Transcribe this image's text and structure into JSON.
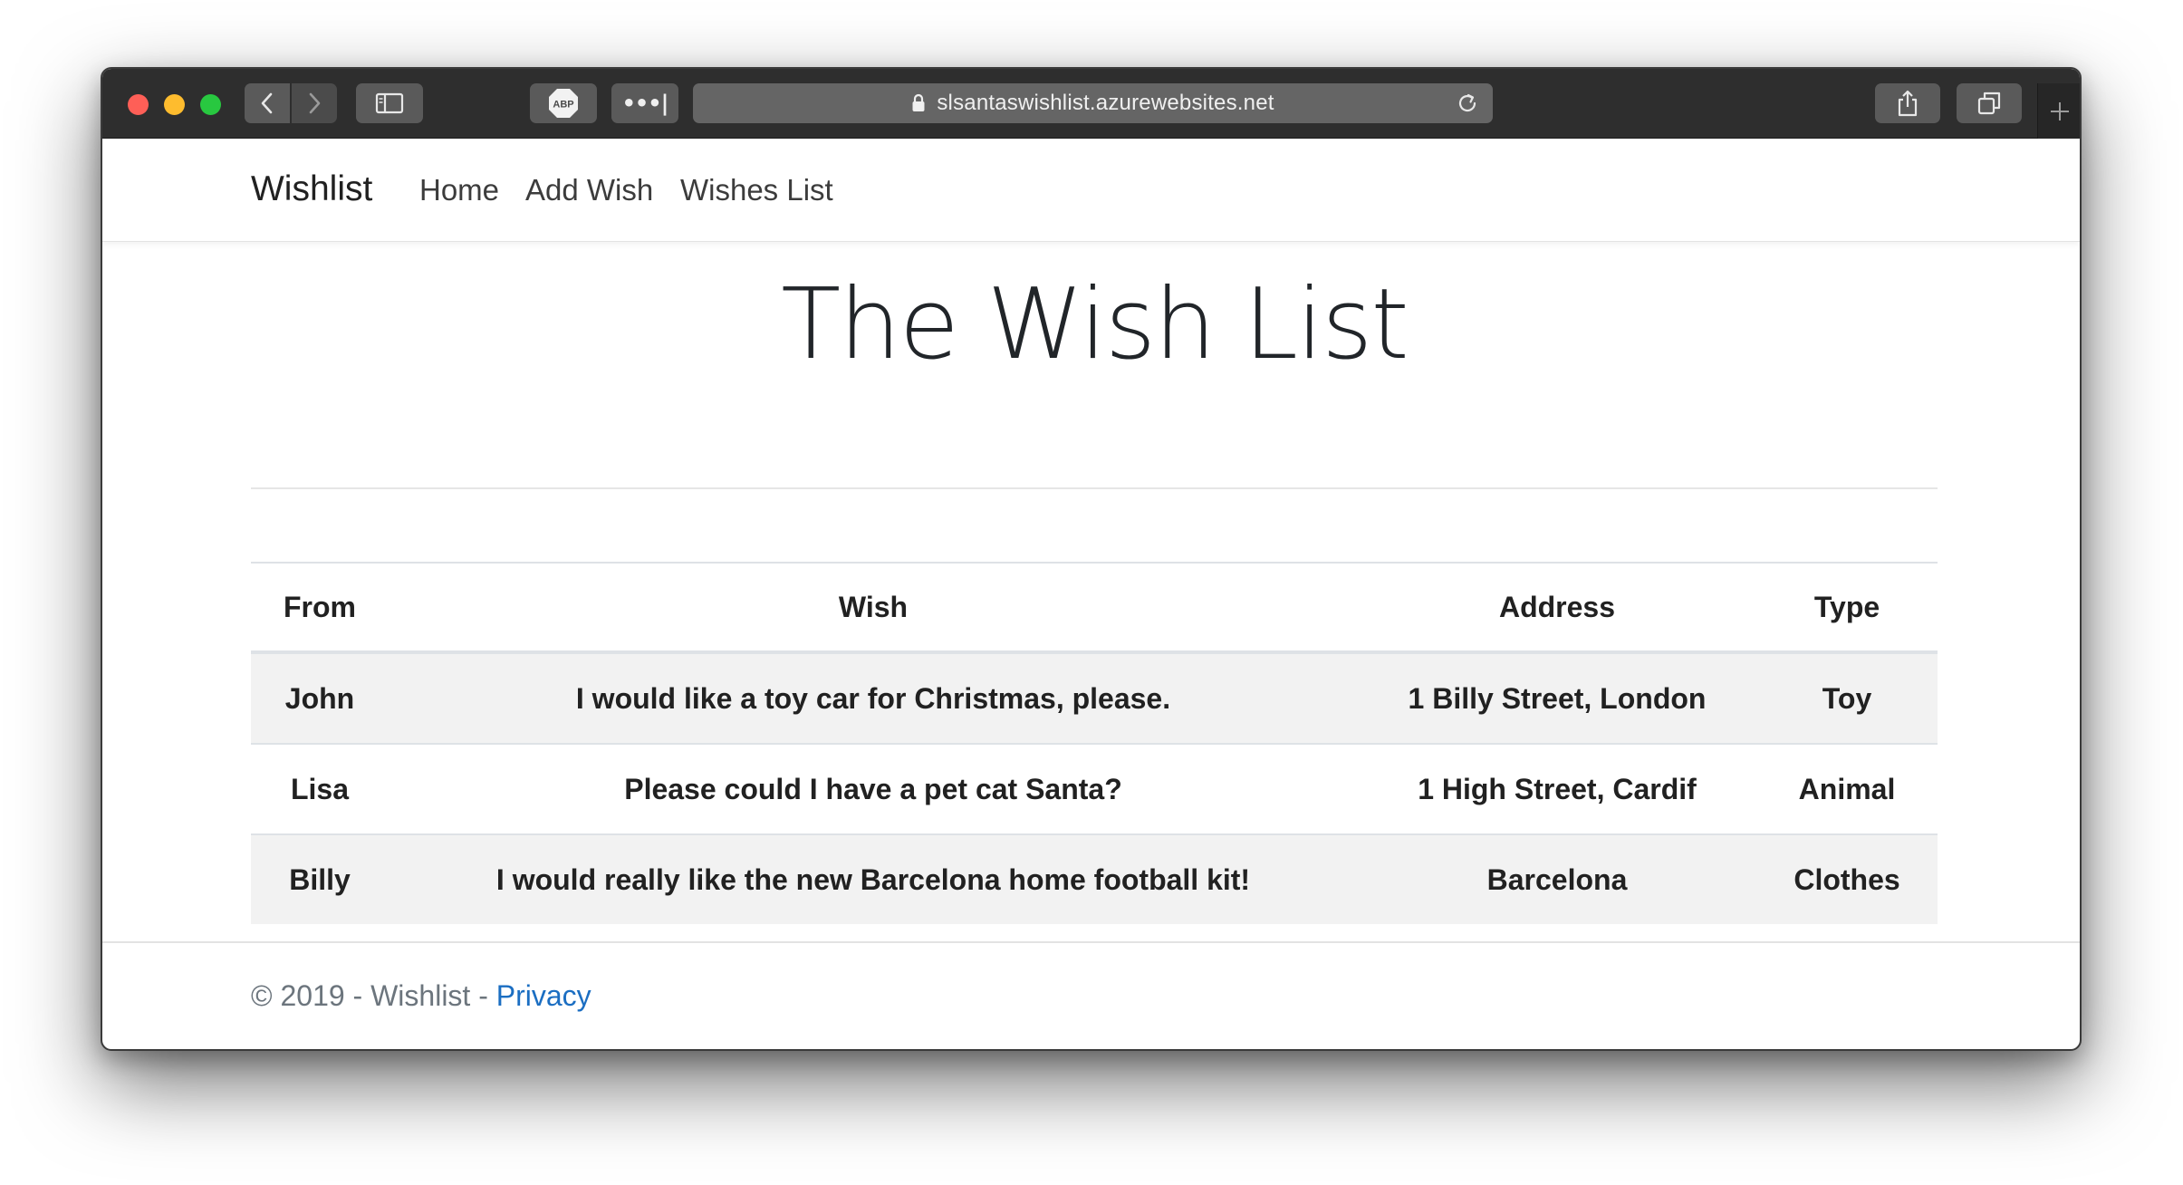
{
  "browser": {
    "url": "slsantaswishlist.azurewebsites.net",
    "adblock_label": "ABP",
    "more_label": "•••|"
  },
  "nav": {
    "brand": "Wishlist",
    "links": [
      "Home",
      "Add Wish",
      "Wishes List"
    ]
  },
  "main": {
    "title": "The Wish List",
    "table": {
      "headers": [
        "From",
        "Wish",
        "Address",
        "Type"
      ],
      "rows": [
        [
          "John",
          "I would like a toy car for Christmas, please.",
          "1 Billy Street, London",
          "Toy"
        ],
        [
          "Lisa",
          "Please could I have a pet cat Santa?",
          "1 High Street, Cardif",
          "Animal"
        ],
        [
          "Billy",
          "I would really like the new Barcelona home football kit!",
          "Barcelona",
          "Clothes"
        ]
      ]
    }
  },
  "footer": {
    "copyright": "© 2019 - Wishlist - ",
    "privacy_label": "Privacy"
  },
  "colors": {
    "close": "#fe5f57",
    "minimize": "#febc2e",
    "zoom": "#28c840",
    "link": "#1b6ec2",
    "striped_row": "#f2f2f2"
  }
}
